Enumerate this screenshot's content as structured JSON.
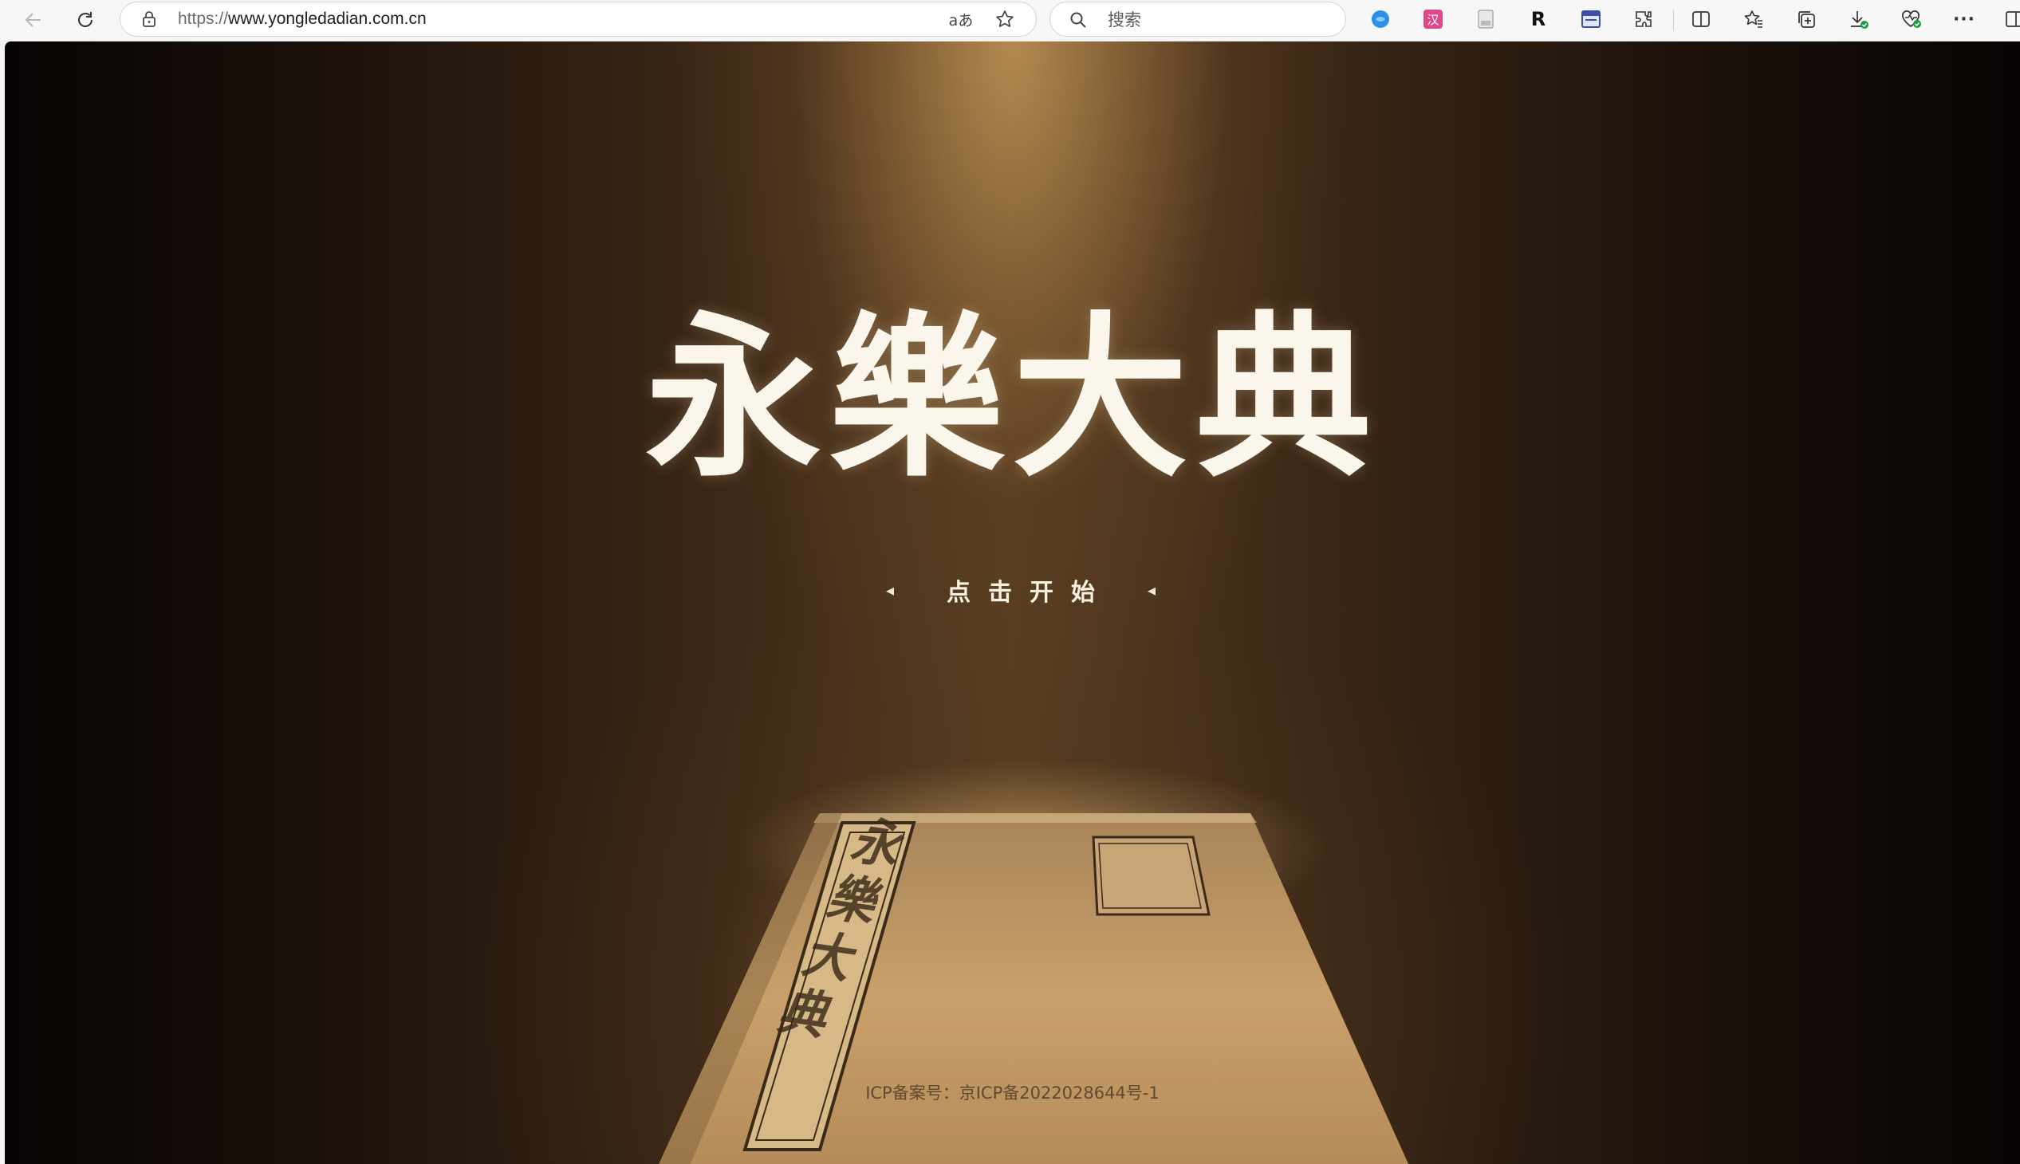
{
  "browser": {
    "url_scheme": "https://",
    "url_host": "www.yongledadian.com.cn",
    "read_aloud_glyph": "aあ",
    "search_placeholder": "搜索",
    "ext_r_label": "R",
    "ext_translate_label": "汉",
    "more_label": "···"
  },
  "page": {
    "title": "永樂大典",
    "start_button": "点击开始",
    "icp": "ICP备案号：京ICP备2022028644号-1",
    "book_title": "永樂大典"
  },
  "colors": {
    "title_text": "#faf6ec",
    "light_beam": "#b88e52",
    "background_dark": "#0d0705",
    "book_cover": "#c9a06a"
  }
}
